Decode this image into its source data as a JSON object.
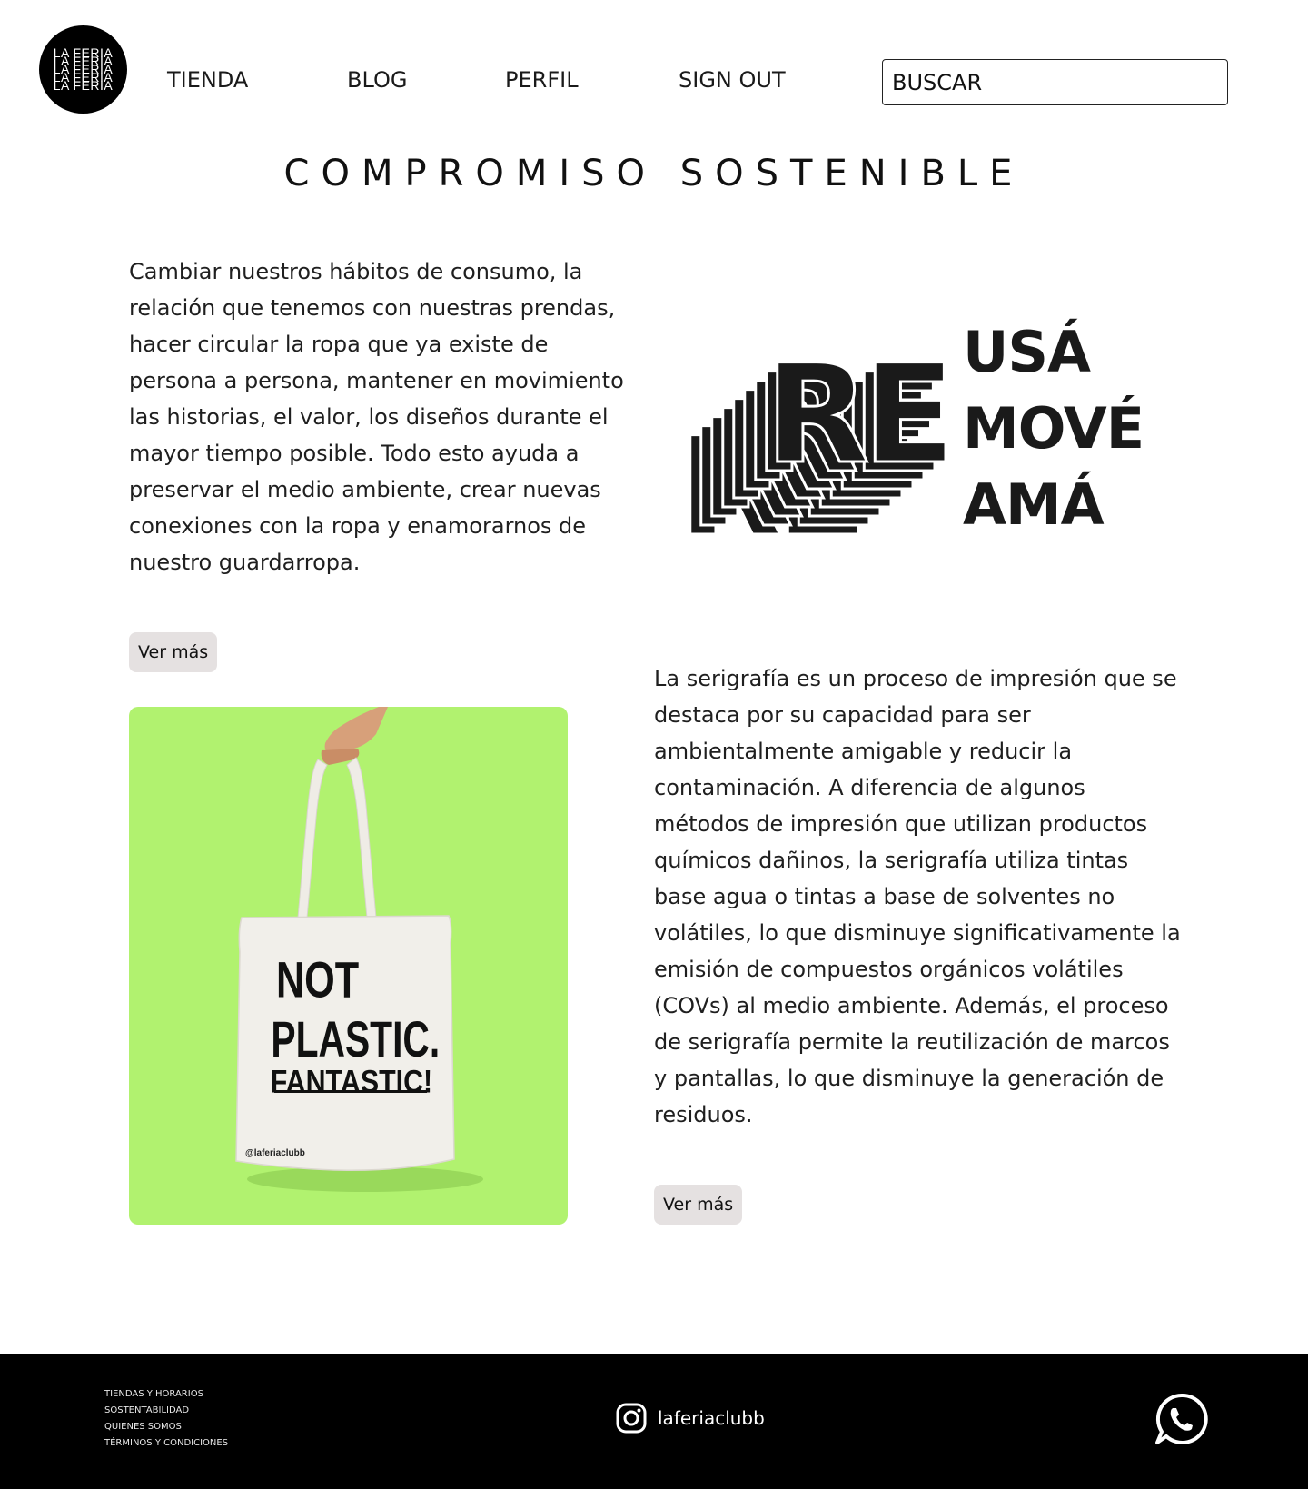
{
  "header": {
    "logo_lines": [
      "LA FERIA",
      "LA FERIA",
      "LA FERIA",
      "LA FERIA",
      "LA FERIA"
    ],
    "nav": [
      {
        "label": "TIENDA"
      },
      {
        "label": "BLOG"
      },
      {
        "label": "PERFIL"
      },
      {
        "label": "SIGN OUT"
      }
    ],
    "search_placeholder": "BUSCAR"
  },
  "main": {
    "title": "COMPROMISO SOSTENIBLE",
    "section1": {
      "text": "Cambiar nuestros hábitos de consumo, la relación que tenemos con nuestras prendas, hacer circular la ropa que ya existe de persona a persona, mantener en movimiento las historias, el valor, los diseños durante el mayor tiempo posible. Todo esto ayuda a preservar el medio ambiente, crear nuevas conexiones con la ropa y enamorarnos de nuestro guardarropa.",
      "button": "Ver más"
    },
    "reuse_graphic": {
      "letters": "RE",
      "words": [
        "USÁ",
        "MOVÉ",
        "AMÁ"
      ]
    },
    "tote_image": {
      "line1": "NOT",
      "line2": "PLASTIC.",
      "line3": "FANTASTIC!",
      "handle": "@laferiaclubb",
      "bg_color": "#b1f26f"
    },
    "section2": {
      "text": "La serigrafía es un proceso de impresión que se destaca por su capacidad para ser ambientalmente amigable y reducir la contaminación. A diferencia de algunos métodos de impresión que utilizan productos químicos dañinos, la serigrafía utiliza tintas base agua o tintas a base de solventes no volátiles, lo que disminuye significativamente la emisión de compuestos orgánicos volátiles (COVs) al medio ambiente. Además, el proceso de serigrafía permite la reutilización de marcos y pantallas, lo que disminuye la generación de residuos.",
      "button": "Ver más"
    }
  },
  "footer": {
    "links": [
      "TIENDAS Y HORARIOS",
      "SOSTENTABILIDAD",
      "QUIENES SOMOS",
      "TÉRMINOS Y CONDICIONES"
    ],
    "instagram_handle": "laferiaclubb",
    "icons": [
      "instagram-icon",
      "whatsapp-icon"
    ]
  }
}
